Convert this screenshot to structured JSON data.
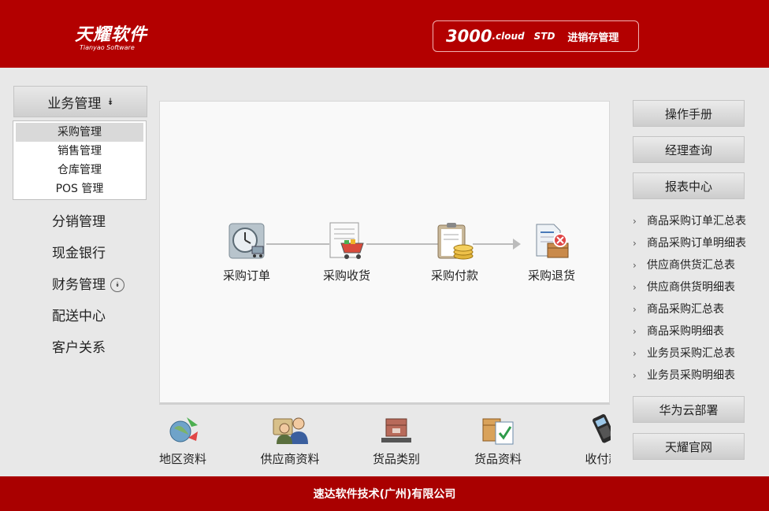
{
  "header": {
    "logo_cn": "天耀软件",
    "logo_en": "Tianyao Software",
    "product_main": "3000",
    "product_cloud": ".cloud",
    "product_std": "STD",
    "product_name": "进销存管理"
  },
  "left_menu": {
    "section_title": "业务管理",
    "sub_items": [
      {
        "label": "采购管理",
        "active": true
      },
      {
        "label": "销售管理",
        "active": false
      },
      {
        "label": "仓库管理",
        "active": false
      },
      {
        "label": "POS 管理",
        "active": false
      }
    ],
    "items": [
      "分销管理",
      "现金银行",
      "财务管理",
      "配送中心",
      "客户关系"
    ]
  },
  "flow": {
    "steps": [
      {
        "label": "采购订单",
        "icon": "clock-cart-icon"
      },
      {
        "label": "采购收货",
        "icon": "cart-receipt-icon"
      },
      {
        "label": "采购付款",
        "icon": "clipboard-coins-icon"
      },
      {
        "label": "采购退货",
        "icon": "return-box-icon"
      }
    ]
  },
  "shortcuts": [
    {
      "label": "地区资料",
      "icon": "region-icon"
    },
    {
      "label": "供应商资料",
      "icon": "supplier-icon"
    },
    {
      "label": "货品类别",
      "icon": "goods-category-icon"
    },
    {
      "label": "货品资料",
      "icon": "goods-info-icon"
    },
    {
      "label": "收付款",
      "icon": "payment-terminal-icon"
    }
  ],
  "right": {
    "buttons": [
      "操作手册",
      "经理查询",
      "报表中心"
    ],
    "reports": [
      "商品采购订单汇总表",
      "商品采购订单明细表",
      "供应商供货汇总表",
      "供应商供货明细表",
      "商品采购汇总表",
      "商品采购明细表",
      "业务员采购汇总表",
      "业务员采购明细表"
    ],
    "bottom_buttons": [
      "华为云部署",
      "天耀官网"
    ]
  },
  "footer": {
    "company": "速达软件技术(广州)有限公司"
  },
  "colors": {
    "brand_red": "#b30000",
    "footer_red": "#a90000"
  }
}
